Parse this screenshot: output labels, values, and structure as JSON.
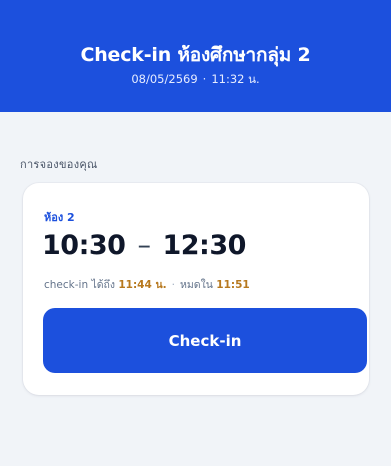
{
  "header": {
    "title": "Check-in ห้องศึกษากลุ่ม 2",
    "date": "08/05/2569",
    "separator": "·",
    "time": "11:32 น."
  },
  "section": {
    "label": "การจองของคุณ"
  },
  "booking": {
    "room": "ห้อง 2",
    "start": "10:30",
    "dash": "–",
    "end": "12:30",
    "checkin_label": "check-in ได้ถึง",
    "checkin_until": "11:44 น.",
    "separator": "·",
    "expire_label": "หมดใน",
    "expire_at": "11:51",
    "button_label": "Check-in"
  },
  "colors": {
    "primary": "#1c50dd",
    "highlight": "#b7791f",
    "background": "#f1f4f8"
  }
}
